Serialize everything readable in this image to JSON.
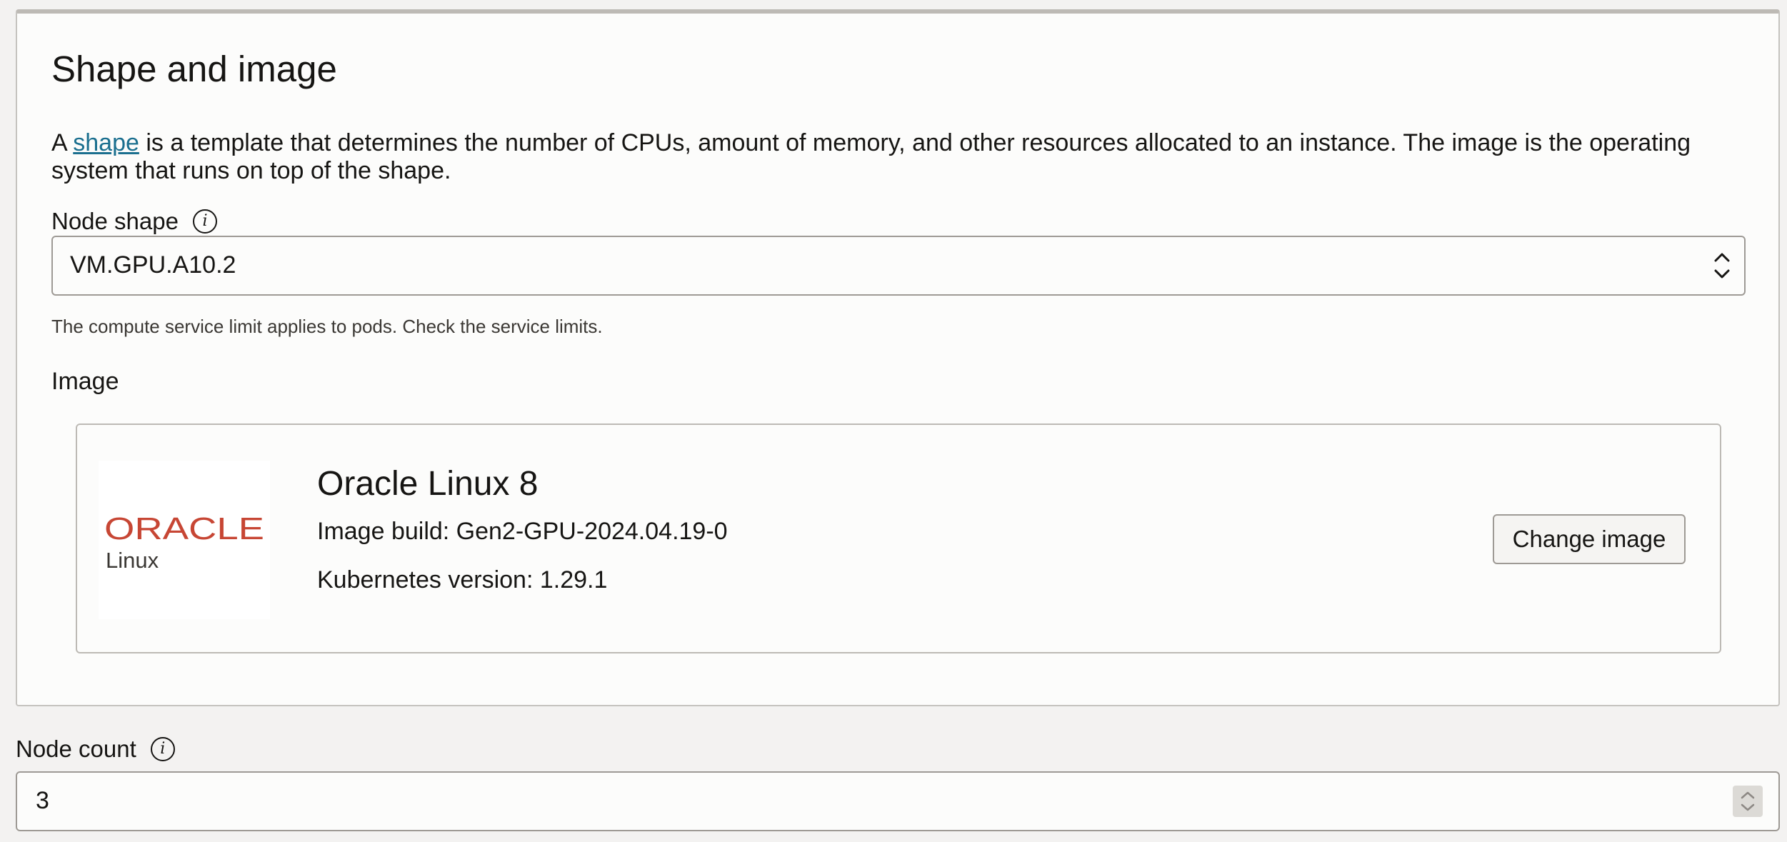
{
  "section": {
    "title": "Shape and image",
    "description": {
      "prefix": "A ",
      "link_text": "shape",
      "suffix": " is a template that determines the number of CPUs, amount of memory, and other resources allocated to an instance. The image is the operating system that runs on top of the shape."
    }
  },
  "node_shape": {
    "label": "Node shape",
    "value": "VM.GPU.A10.2",
    "help": "The compute service limit applies to pods. Check the service limits."
  },
  "image": {
    "label": "Image",
    "logo_brand": "ORACLE",
    "logo_product": "Linux",
    "name": "Oracle Linux 8",
    "build": "Image build: Gen2-GPU-2024.04.19-0",
    "kubernetes": "Kubernetes version: 1.29.1",
    "change_label": "Change image"
  },
  "node_count": {
    "label": "Node count",
    "value": "3"
  },
  "colors": {
    "link": "#1b6f8f",
    "oracle_red": "#c74634",
    "panel_bg": "#fcfcfb",
    "page_bg": "#f3f2f1"
  }
}
